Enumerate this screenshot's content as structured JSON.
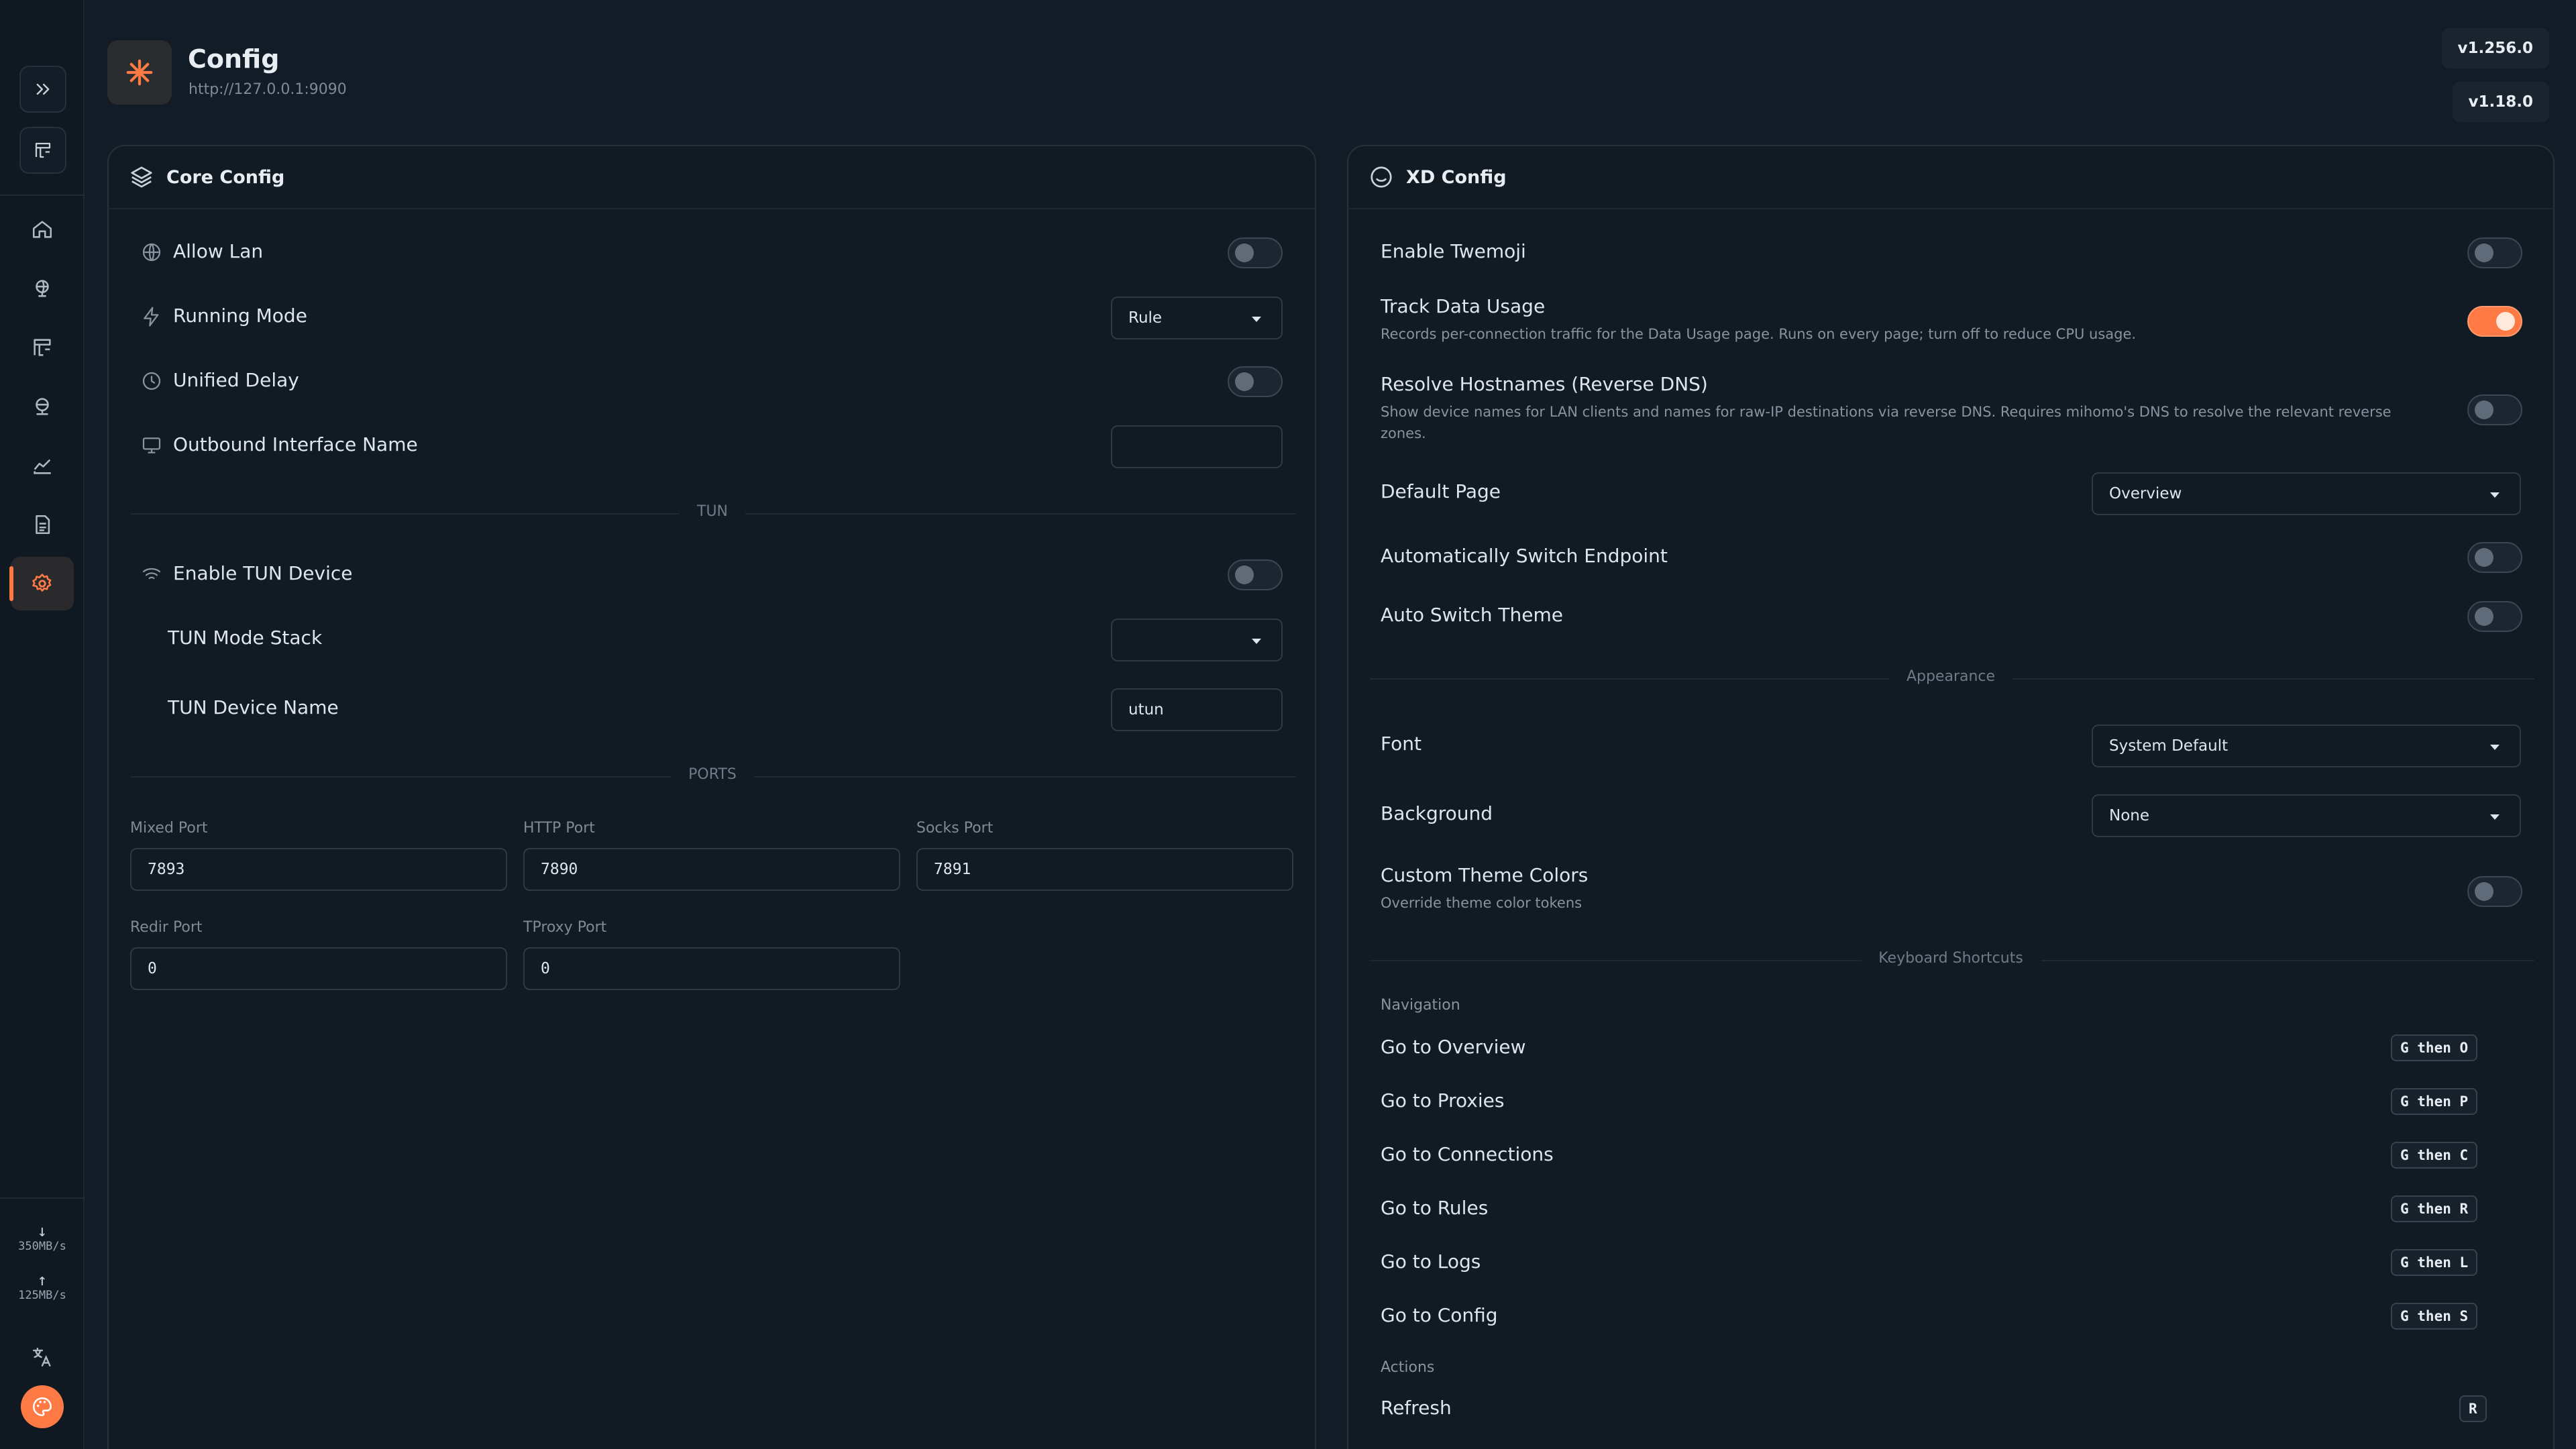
{
  "header": {
    "title": "Config",
    "url": "http://127.0.0.1:9090",
    "versions": [
      "v1.256.0",
      "v1.18.0"
    ]
  },
  "sidebar": {
    "items": [
      {
        "icon": "home-icon",
        "active": false
      },
      {
        "icon": "globe-icon",
        "active": false
      },
      {
        "icon": "rules-icon",
        "active": false
      },
      {
        "icon": "network-icon",
        "active": false
      },
      {
        "icon": "chart-icon",
        "active": false
      },
      {
        "icon": "logs-icon",
        "active": false
      },
      {
        "icon": "gear-icon",
        "active": true
      }
    ],
    "download_speed": "350MB/s",
    "upload_speed": "125MB/s"
  },
  "core": {
    "title": "Core Config",
    "allow_lan": {
      "label": "Allow Lan",
      "on": false
    },
    "running_mode": {
      "label": "Running Mode",
      "value": "Rule"
    },
    "unified_delay": {
      "label": "Unified Delay",
      "on": false
    },
    "outbound_interface": {
      "label": "Outbound Interface Name",
      "value": ""
    },
    "tun_divider": "TUN",
    "enable_tun": {
      "label": "Enable TUN Device",
      "on": false
    },
    "tun_stack": {
      "label": "TUN Mode Stack",
      "value": ""
    },
    "tun_device": {
      "label": "TUN Device Name",
      "value": "utun"
    },
    "ports_divider": "PORTS",
    "ports": {
      "mixed": {
        "label": "Mixed Port",
        "value": "7893"
      },
      "http": {
        "label": "HTTP Port",
        "value": "7890"
      },
      "socks": {
        "label": "Socks Port",
        "value": "7891"
      },
      "redir": {
        "label": "Redir Port",
        "value": "0"
      },
      "tproxy": {
        "label": "TProxy Port",
        "value": "0"
      }
    }
  },
  "xd": {
    "title": "XD Config",
    "twemoji": {
      "label": "Enable Twemoji",
      "on": false
    },
    "track_usage": {
      "label": "Track Data Usage",
      "desc": "Records per-connection traffic for the Data Usage page. Runs on every page; turn off to reduce CPU usage.",
      "on": true
    },
    "reverse_dns": {
      "label": "Resolve Hostnames (Reverse DNS)",
      "desc1": "Show device names for LAN clients and names for raw-IP destinations via reverse DNS. Requires mihomo's DNS to resolve the relevant reverse",
      "desc2": "zones.",
      "on": false
    },
    "default_page": {
      "label": "Default Page",
      "value": "Overview"
    },
    "auto_endpoint": {
      "label": "Automatically Switch Endpoint",
      "on": false
    },
    "auto_theme": {
      "label": "Auto Switch Theme",
      "on": false
    },
    "appearance_divider": "Appearance",
    "font": {
      "label": "Font",
      "value": "System Default"
    },
    "background": {
      "label": "Background",
      "value": "None"
    },
    "custom_colors": {
      "label": "Custom Theme Colors",
      "desc": "Override theme color tokens",
      "on": false
    },
    "shortcuts_divider": "Keyboard Shortcuts",
    "navigation_label": "Navigation",
    "shortcuts": [
      {
        "label": "Go to Overview",
        "keys": "G then O"
      },
      {
        "label": "Go to Proxies",
        "keys": "G then P"
      },
      {
        "label": "Go to Connections",
        "keys": "G then C"
      },
      {
        "label": "Go to Rules",
        "keys": "G then R"
      },
      {
        "label": "Go to Logs",
        "keys": "G then L"
      },
      {
        "label": "Go to Config",
        "keys": "G then S"
      }
    ],
    "actions_label": "Actions",
    "refresh": {
      "label": "Refresh",
      "keys": "R"
    }
  },
  "colors": {
    "accent": "#ff7a45",
    "background": "#121c26",
    "card": "#111b24"
  }
}
